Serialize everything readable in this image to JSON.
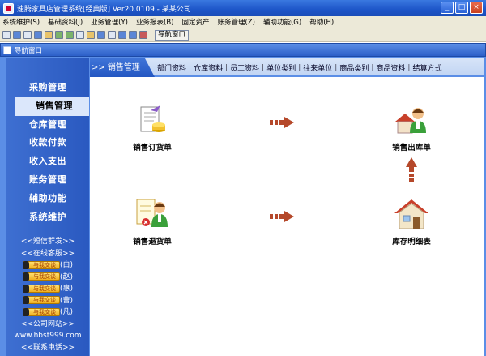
{
  "window": {
    "title": "速腾家具店管理系统[经典版] Ver20.0109 - 某某公司",
    "minimize": "_",
    "maximize": "□",
    "close": "×"
  },
  "menu": [
    "系统维护(S)",
    "基础资料(J)",
    "业务管理(Y)",
    "业务报表(B)",
    "固定资产",
    "账务管理(Z)",
    "辅助功能(G)",
    "帮助(H)"
  ],
  "toolbar": {
    "nav_button": "导航窗口"
  },
  "subwindow": {
    "title": "导航窗口"
  },
  "sidebar": {
    "items": [
      "采购管理",
      "销售管理",
      "仓库管理",
      "收款付款",
      "收入支出",
      "账务管理",
      "辅助功能",
      "系统维护"
    ],
    "active": "销售管理"
  },
  "side_info": {
    "sms": "<<短信群发>>",
    "online": "<<在线客服>>",
    "qq_label": "与我交谈",
    "qq_names": [
      "(白)",
      "(赵)",
      "(惠)",
      "(曹)",
      "(凡)"
    ],
    "website_label": "<<公司网站>>",
    "website": "www.hbst999.com",
    "phone_label": "<<联系电话>>"
  },
  "tabs": {
    "current": ">> 销售管理",
    "items": [
      "部门资料",
      "仓库资料",
      "员工资料",
      "单位类别",
      "往来单位",
      "商品类别",
      "商品资料",
      "结算方式"
    ]
  },
  "flow": {
    "sales_order": "销售订货单",
    "sales_outbound": "销售出库单",
    "sales_return": "销售退货单",
    "inventory_detail": "库存明细表"
  },
  "colors": {
    "accent": "#2c5fc8",
    "arrow": "#b5482a"
  }
}
